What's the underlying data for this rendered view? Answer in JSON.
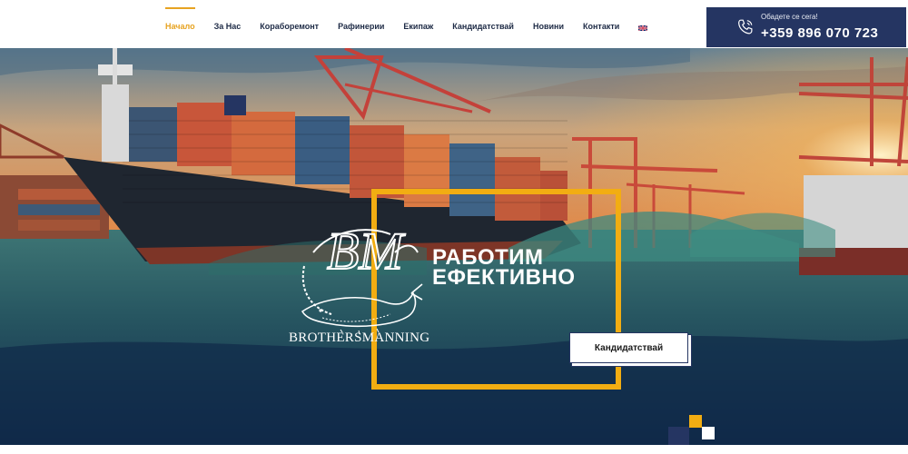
{
  "nav": {
    "items": [
      {
        "label": "Начало",
        "active": true
      },
      {
        "label": "За Нас",
        "active": false
      },
      {
        "label": "Кораборемонт",
        "active": false
      },
      {
        "label": "Рафинерии",
        "active": false
      },
      {
        "label": "Екипаж",
        "active": false
      },
      {
        "label": "Кандидатствай",
        "active": false
      },
      {
        "label": "Новини",
        "active": false
      },
      {
        "label": "Контакти",
        "active": false
      }
    ],
    "language_icon": "uk-flag-icon"
  },
  "call": {
    "label": "Обадете се сега!",
    "number": "+359 896 070 723",
    "icon": "phone-icon"
  },
  "hero": {
    "headline_line1": "РАБОТИМ",
    "headline_line2": "ЕФЕКТИВНО",
    "logo_text": "BROTHERSMANNING",
    "logo_monogram": "BM",
    "cta_label": "Кандидатствай"
  },
  "colors": {
    "accent": "#e7a321",
    "frame": "#f2ad12",
    "navy": "#253562",
    "nav_text": "#1d2a45"
  }
}
